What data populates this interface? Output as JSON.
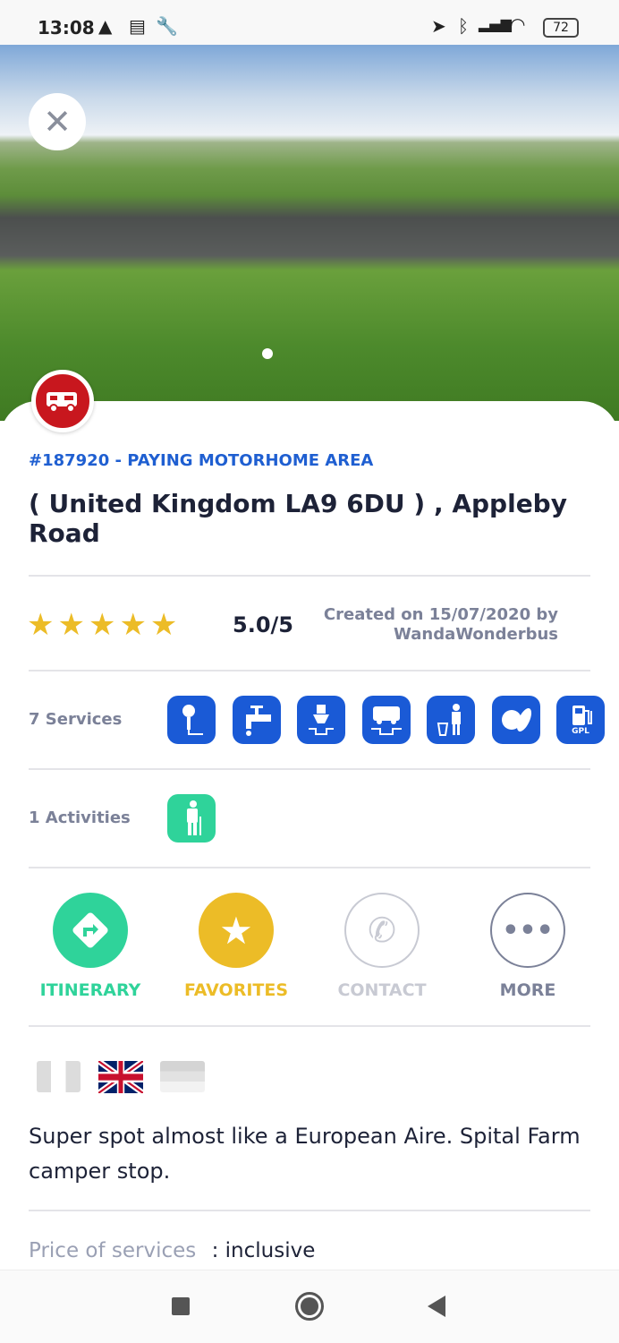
{
  "status_bar": {
    "time": "13:08",
    "battery": "72",
    "icons": [
      "warning-icon",
      "notes-icon",
      "wrench-icon",
      "location-icon",
      "bluetooth-icon",
      "signal-icon",
      "wifi-icon",
      "battery-icon"
    ]
  },
  "place": {
    "id_type": "#187920 - PAYING MOTORHOME AREA",
    "title": "( United Kingdom LA9 6DU ) ,  Appleby Road"
  },
  "rating": {
    "stars": 5,
    "value": "5.0/5",
    "created": "Created on 15/07/2020 by",
    "author": "WandaWonderbus"
  },
  "services": {
    "label": "7 Services",
    "icons": [
      "electricity-icon",
      "water-tap-icon",
      "toilet-dump-icon",
      "motorhome-drain-icon",
      "trash-icon",
      "bread-icon",
      "gpl-fuel-icon"
    ],
    "gpl_text": "GPL",
    "color": "#1a5ad6"
  },
  "activities": {
    "label": "1 Activities",
    "icons": [
      "hiking-icon"
    ],
    "color": "#2fd39a"
  },
  "actions": [
    {
      "label": "ITINERARY",
      "color": "#2fd39a"
    },
    {
      "label": "FAVORITES",
      "color": "#ecbc27"
    },
    {
      "label": "CONTACT",
      "color": "#c8cad3"
    },
    {
      "label": "MORE",
      "color": "#7b8198"
    }
  ],
  "description": "Super spot almost like a European Aire. Spital Farm camper stop.",
  "price": {
    "label": "Price of services",
    "value": ": inclusive"
  }
}
